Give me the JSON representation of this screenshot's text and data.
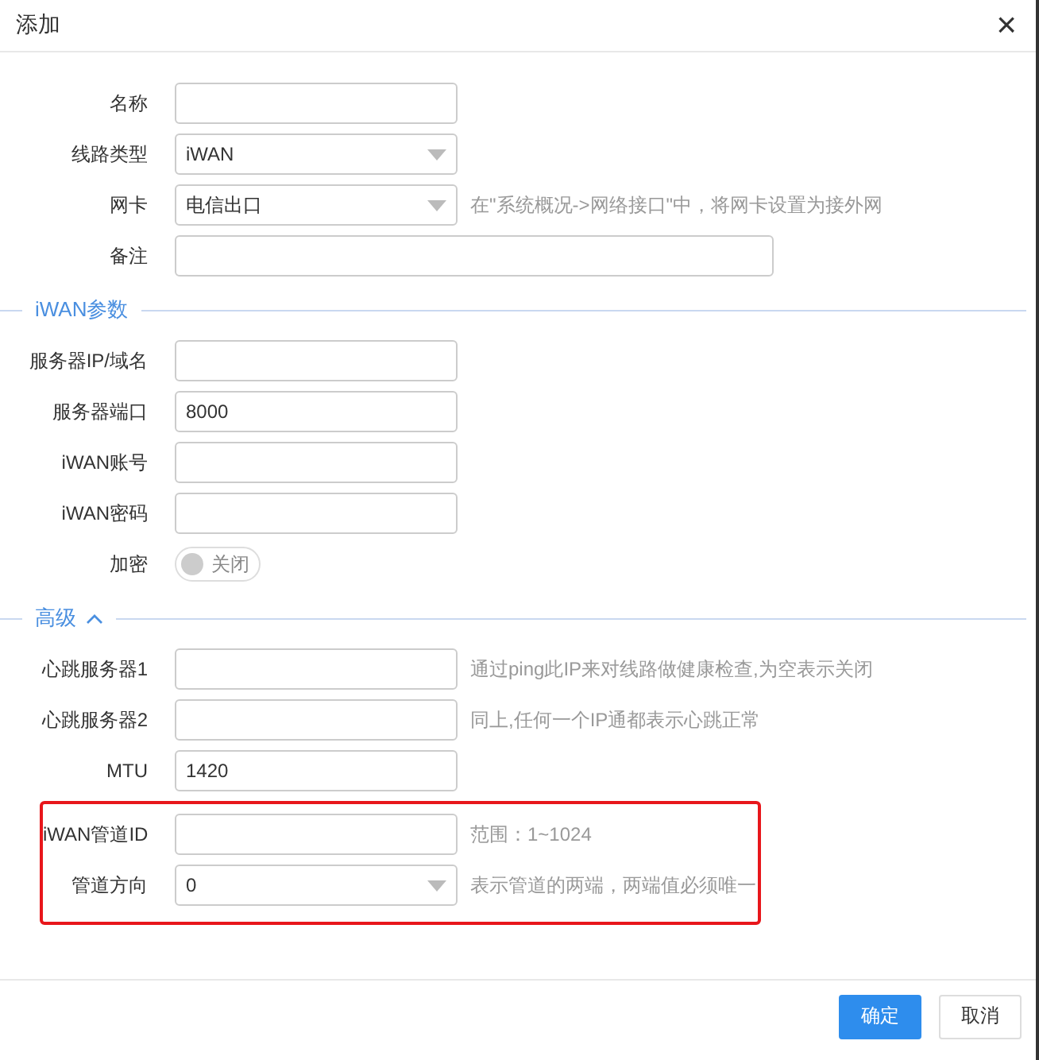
{
  "dialog": {
    "title": "添加",
    "close": "×"
  },
  "sections": [
    {
      "kind": "plain",
      "items": [
        {
          "kind": "input",
          "label": "名称",
          "value": "",
          "wide": false
        },
        {
          "kind": "select",
          "label": "线路类型",
          "value": "iWAN"
        },
        {
          "kind": "select",
          "label": "网卡",
          "value": "电信出口",
          "hint": "在\"系统概况->网络接口\"中，将网卡设置为接外网"
        },
        {
          "kind": "input",
          "label": "备注",
          "value": "",
          "wide": true
        }
      ]
    },
    {
      "kind": "titled",
      "title": "iWAN参数",
      "items": [
        {
          "kind": "input",
          "label": "服务器IP/域名",
          "value": "",
          "wide": false
        },
        {
          "kind": "input",
          "label": "服务器端口",
          "value": "8000",
          "wide": false
        },
        {
          "kind": "input",
          "label": "iWAN账号",
          "value": "",
          "wide": false
        },
        {
          "kind": "input",
          "label": "iWAN密码",
          "value": "",
          "wide": false
        },
        {
          "kind": "toggle",
          "label": "加密",
          "on": false,
          "state_text": "关闭"
        }
      ]
    },
    {
      "kind": "collapsible",
      "title": "高级",
      "expanded": true,
      "items": [
        {
          "kind": "input",
          "label": "心跳服务器1",
          "value": "",
          "wide": false,
          "hint": "通过ping此IP来对线路做健康检查,为空表示关闭"
        },
        {
          "kind": "input",
          "label": "心跳服务器2",
          "value": "",
          "wide": false,
          "hint": "同上,任何一个IP通都表示心跳正常"
        },
        {
          "kind": "input",
          "label": "MTU",
          "value": "1420",
          "wide": false
        },
        {
          "kind": "highlight",
          "items": [
            {
              "kind": "input",
              "label": "iWAN管道ID",
              "value": "",
              "wide": false,
              "hint": "范围：1~1024"
            },
            {
              "kind": "select",
              "label": "管道方向",
              "value": "0",
              "hint": "表示管道的两端，两端值必须唯一"
            }
          ]
        }
      ]
    }
  ],
  "buttons": [
    {
      "label": "确定",
      "primary": true
    },
    {
      "label": "取消",
      "primary": false
    }
  ]
}
